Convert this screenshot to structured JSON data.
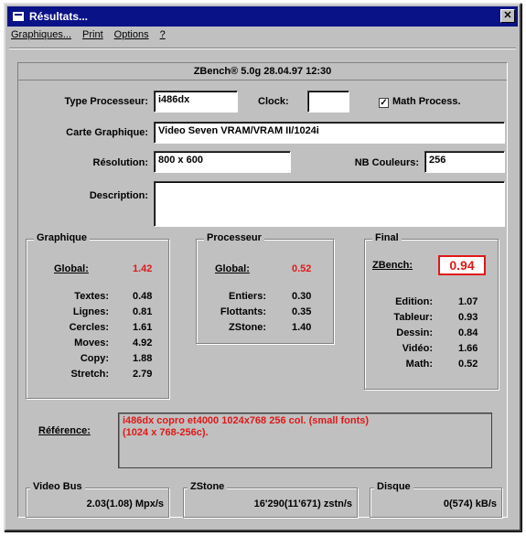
{
  "window": {
    "title": "Résultats...",
    "close_glyph": "✕"
  },
  "menu": {
    "items": [
      "Graphiques...",
      "Print",
      "Options",
      "?"
    ]
  },
  "header": {
    "line": "ZBench®  5.0g   28.04.97  12:30"
  },
  "form": {
    "type_processeur": {
      "label": "Type Processeur:",
      "value": "i486dx"
    },
    "clock": {
      "label": "Clock:",
      "value": ""
    },
    "math_process": {
      "label": "Math Process.",
      "checked": true,
      "mark": "✓"
    },
    "carte_graphique": {
      "label": "Carte Graphique:",
      "value": "Video Seven VRAM/VRAM II/1024i"
    },
    "resolution": {
      "label": "Résolution:",
      "value": "800 x 600"
    },
    "nb_couleurs": {
      "label": "NB Couleurs:",
      "value": "256"
    },
    "description": {
      "label": "Description:",
      "value": ""
    }
  },
  "graphique": {
    "title": "Graphique",
    "global_label": "Global:",
    "global_value": "1.42",
    "rows": [
      {
        "label": "Textes:",
        "value": "0.48"
      },
      {
        "label": "Lignes:",
        "value": "0.81"
      },
      {
        "label": "Cercles:",
        "value": "1.61"
      },
      {
        "label": "Moves:",
        "value": "4.92"
      },
      {
        "label": "Copy:",
        "value": "1.88"
      },
      {
        "label": "Stretch:",
        "value": "2.79"
      }
    ]
  },
  "processeur": {
    "title": "Processeur",
    "global_label": "Global:",
    "global_value": "0.52",
    "rows": [
      {
        "label": "Entiers:",
        "value": "0.30"
      },
      {
        "label": "Flottants:",
        "value": "0.35"
      },
      {
        "label": "ZStone:",
        "value": "1.40"
      }
    ]
  },
  "final": {
    "title": "Final",
    "zbench_label": "ZBench:",
    "zbench_value": "0.94",
    "rows": [
      {
        "label": "Edition:",
        "value": "1.07"
      },
      {
        "label": "Tableur:",
        "value": "0.93"
      },
      {
        "label": "Dessin:",
        "value": "0.84"
      },
      {
        "label": "Vidéo:",
        "value": "1.66"
      },
      {
        "label": "Math:",
        "value": "0.52"
      }
    ]
  },
  "reference": {
    "label": "Référence:",
    "line1": "i486dx copro   et4000 1024x768     256 col. (small fonts)",
    "line2": "(1024 x 768-256c)."
  },
  "bottom": {
    "video_bus": {
      "title": "Video Bus",
      "value": "2.03(1.08) Mpx/s"
    },
    "zstone": {
      "title": "ZStone",
      "value": "16'290(11'671) zstn/s"
    },
    "disque": {
      "title": "Disque",
      "value": "0(574) kB/s"
    }
  },
  "colors": {
    "title_bar": "#0a1288",
    "face": "#c0c0c0",
    "accent_red": "#e01818"
  }
}
